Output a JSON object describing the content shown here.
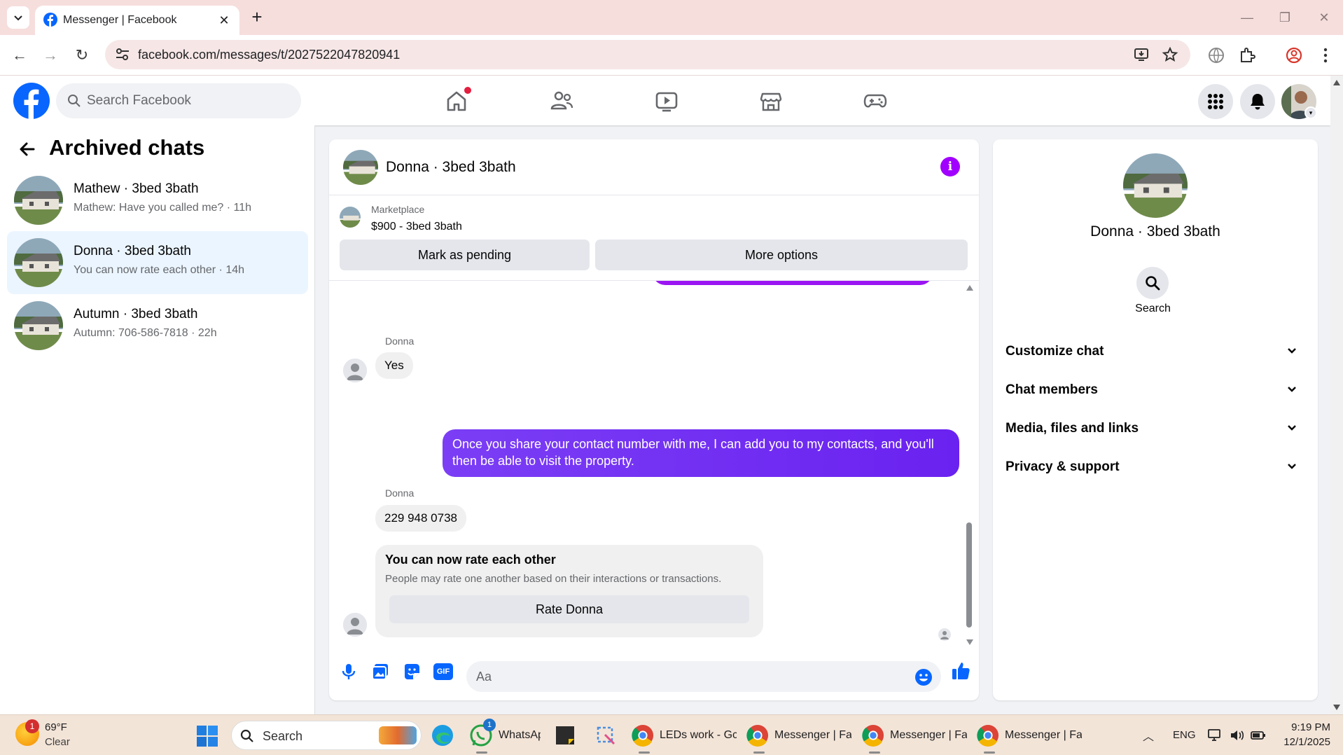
{
  "browser": {
    "tab_title": "Messenger | Facebook",
    "url": "facebook.com/messages/t/2027522047820941",
    "new_tab": "+",
    "close_tab": "✕"
  },
  "header": {
    "search_placeholder": "Search Facebook",
    "nav_icons": [
      "home-icon",
      "friends-icon",
      "video-icon",
      "marketplace-icon",
      "gaming-icon"
    ],
    "right_icons": [
      "menu-grid-icon",
      "notifications-icon",
      "profile-avatar"
    ]
  },
  "sidebar": {
    "title": "Archived chats",
    "chats": [
      {
        "name": "Mathew · 3bed 3bath",
        "preview": "Mathew: Have you called me? · 11h",
        "selected": false
      },
      {
        "name": "Donna · 3bed 3bath",
        "preview": "You can now rate each other · 14h",
        "selected": true
      },
      {
        "name": "Autumn · 3bed 3bath",
        "preview": "Autumn: 706-586-7818 · 22h",
        "selected": false
      }
    ]
  },
  "conversation": {
    "title": "Donna · 3bed 3bath",
    "info_icon": "i",
    "marketplace": {
      "label": "Marketplace",
      "item": "$900 - 3bed 3bath",
      "pending_button": "Mark as pending",
      "more_button": "More options"
    },
    "messages": [
      {
        "sender": "Donna",
        "text": "Yes",
        "direction": "in"
      },
      {
        "sender": "me",
        "text": "Once you share your contact number with me, I can add you to my contacts, and you'll then be able to visit the property.",
        "direction": "out"
      },
      {
        "sender": "Donna",
        "text": "229 948 0738",
        "direction": "in"
      }
    ],
    "rating_card": {
      "title": "You can now rate each other",
      "subtitle": "People may rate one another based on their interactions or transactions.",
      "button": "Rate Donna"
    },
    "composer": {
      "placeholder": "Aa",
      "icons": [
        "microphone-icon",
        "photo-icon",
        "sticker-icon",
        "gif-icon",
        "emoji-icon",
        "thumbs-up-icon"
      ],
      "gif_label": "GIF"
    }
  },
  "info_panel": {
    "name": "Donna · 3bed 3bath",
    "search_label": "Search",
    "sections": [
      "Customize chat",
      "Chat members",
      "Media, files and links",
      "Privacy & support"
    ]
  },
  "taskbar": {
    "weather_temp": "69°F",
    "weather_condition": "Clear",
    "weather_badge": "1",
    "search_label": "Search",
    "apps": [
      {
        "label": "WhatsApp",
        "badge": "1"
      },
      {
        "label": "LEDs work - Gc"
      },
      {
        "label": "Messenger | Fa"
      },
      {
        "label": "Messenger | Fa"
      },
      {
        "label": "Messenger | Fa"
      }
    ],
    "language": "ENG",
    "time": "9:19 PM",
    "date": "12/1/2025"
  },
  "colors": {
    "accent_purple": "#7b3ef5",
    "facebook_blue": "#0866ff",
    "selected_chat_bg": "#ebf5ff",
    "notification_red": "#e41e3f"
  }
}
